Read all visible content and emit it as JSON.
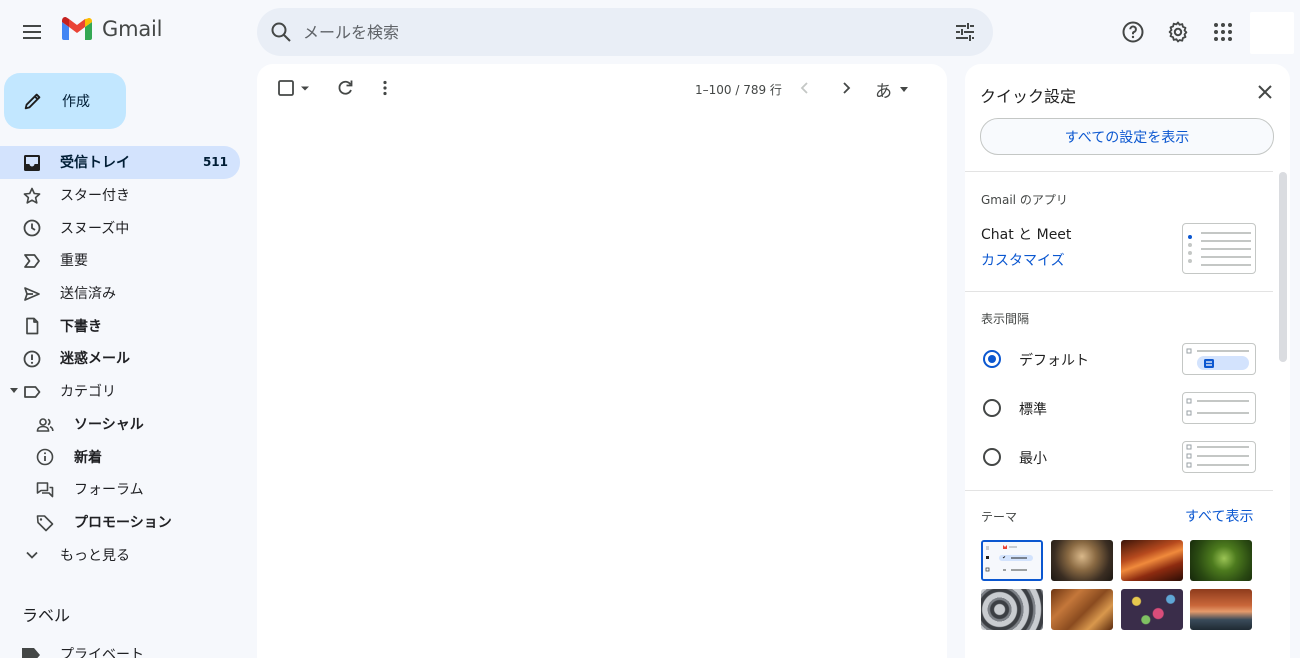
{
  "app": {
    "logo_text": "Gmail"
  },
  "search": {
    "placeholder": "メールを検索"
  },
  "compose": {
    "label": "作成"
  },
  "nav": {
    "inbox": {
      "label": "受信トレイ",
      "count": "511"
    },
    "starred": "スター付き",
    "snoozed": "スヌーズ中",
    "important": "重要",
    "sent": "送信済み",
    "drafts": "下書き",
    "spam": "迷惑メール",
    "categories": "カテゴリ",
    "social": "ソーシャル",
    "updates": "新着",
    "forums": "フォーラム",
    "promotions": "プロモーション",
    "more": "もっと見る"
  },
  "labels": {
    "heading": "ラベル",
    "private": "プライベート"
  },
  "toolbar": {
    "pager": "1–100 / 789 行",
    "ime": "あ"
  },
  "quick_settings": {
    "title": "クイック設定",
    "all_settings": "すべての設定を表示",
    "apps_heading": "Gmail のアプリ",
    "app_name": "Chat と Meet",
    "customize": "カスタマイズ",
    "density_heading": "表示間隔",
    "density_options": [
      "デフォルト",
      "標準",
      "最小"
    ],
    "density_selected": "デフォルト",
    "theme_heading": "テーマ",
    "theme_see_all": "すべて表示"
  },
  "colors": {
    "accent": "#0b57d0",
    "active_nav": "#d3e3fd",
    "compose": "#c2e7ff",
    "search_bg": "#e9eef6"
  }
}
